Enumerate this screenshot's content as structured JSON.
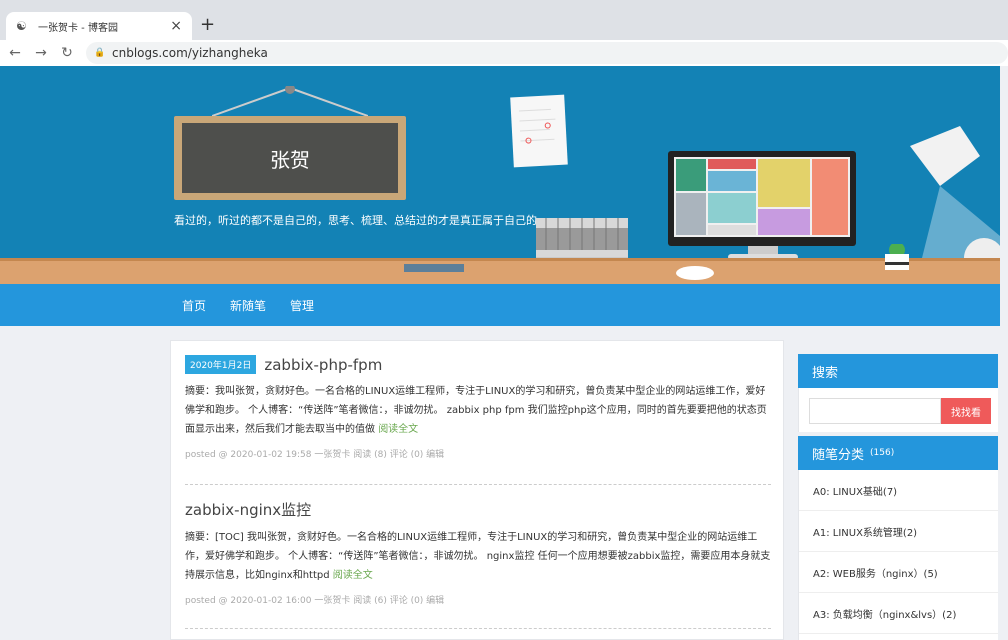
{
  "browser": {
    "tab_title": "一张贺卡 - 博客园",
    "tab_close": "×",
    "new_tab": "+",
    "url": "cnblogs.com/yizhangheka"
  },
  "banner": {
    "name": "张贺",
    "motto": "看过的，听过的都不是自己的，思考、梳理、总结过的才是真正属于自己的。"
  },
  "navbar": {
    "items": [
      "首页",
      "新随笔",
      "管理"
    ]
  },
  "posts": [
    {
      "date": "2020年1月2日",
      "title": "zabbix-php-fpm",
      "summary": "摘要：我叫张贺，贪财好色。一名合格的LINUX运维工程师，专注于LINUX的学习和研究，曾负责某中型企业的网站运维工作，爱好佛学和跑步。 个人博客：“传送阵”笔者微信：，非诚勿扰。 zabbix php fpm 我们监控php这个应用，同时的首先要要把他的状态页面显示出来，然后我们才能去取当中的值做",
      "read_more": "阅读全文",
      "meta": "posted @ 2020-01-02 19:58 一张贺卡 阅读 (8) 评论 (0) 编辑"
    },
    {
      "date": "",
      "title": "zabbix-nginx监控",
      "summary": "摘要：[TOC] 我叫张贺，贪财好色。一名合格的LINUX运维工程师，专注于LINUX的学习和研究，曾负责某中型企业的网站运维工作，爱好佛学和跑步。 个人博客：“传送阵”笔者微信：，非诚勿扰。 nginx监控 任何一个应用想要被zabbix监控，需要应用本身就支持展示信息，比如nginx和httpd",
      "read_more": "阅读全文",
      "meta": "posted @ 2020-01-02 16:00 一张贺卡 阅读 (6) 评论 (0) 编辑"
    }
  ],
  "sidebar": {
    "search_title": "搜索",
    "search_button": "找找看",
    "category_title": "随笔分类",
    "category_count": "(156)",
    "categories": [
      "A0: LINUX基础(7)",
      "A1: LINUX系统管理(2)",
      "A2: WEB服务（nginx）(5)",
      "A3: 负载均衡（nginx&lvs）(2)"
    ]
  }
}
